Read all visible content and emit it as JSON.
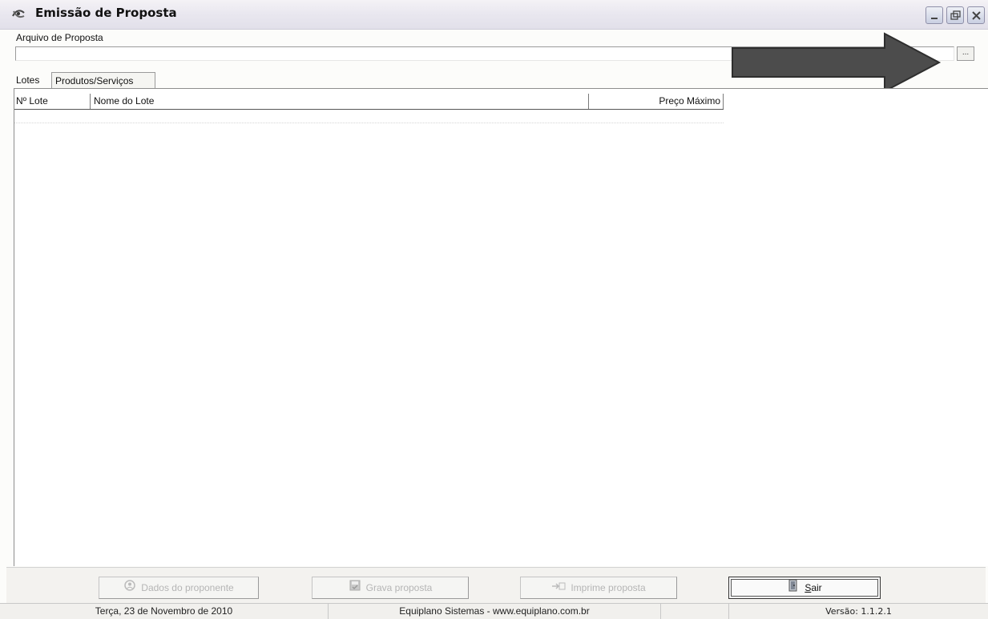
{
  "window": {
    "title": "Emissão de Proposta",
    "accent_color": "#3a3a3a",
    "controls": [
      "minimize-icon",
      "restore-icon",
      "close-icon"
    ]
  },
  "file": {
    "label": "Arquivo de Proposta",
    "value": "",
    "browse_label": "..."
  },
  "tabs": [
    {
      "label": "Lotes",
      "selected": true
    },
    {
      "label": "Produtos/Serviços",
      "selected": false
    }
  ],
  "grid": {
    "columns": [
      "Nº Lote",
      "Nome do Lote",
      "Preço Máximo"
    ],
    "rows": []
  },
  "buttons": {
    "dados": {
      "label": "Dados do proponente",
      "enabled": false,
      "icon": "user-icon"
    },
    "grava": {
      "label": "Grava proposta",
      "enabled": false,
      "icon": "save-icon"
    },
    "imprime": {
      "label": "Imprime proposta",
      "enabled": false,
      "icon": "print-icon"
    },
    "sair": {
      "label_prefix": "",
      "label_accel": "S",
      "label_rest": "air",
      "enabled": true,
      "icon": "exit-door-icon"
    }
  },
  "status": {
    "date": "Terça, 23 de Novembro de 2010",
    "company": "Equiplano Sistemas - www.equiplano.com.br",
    "version": "Versão: 1.1.2.1"
  }
}
